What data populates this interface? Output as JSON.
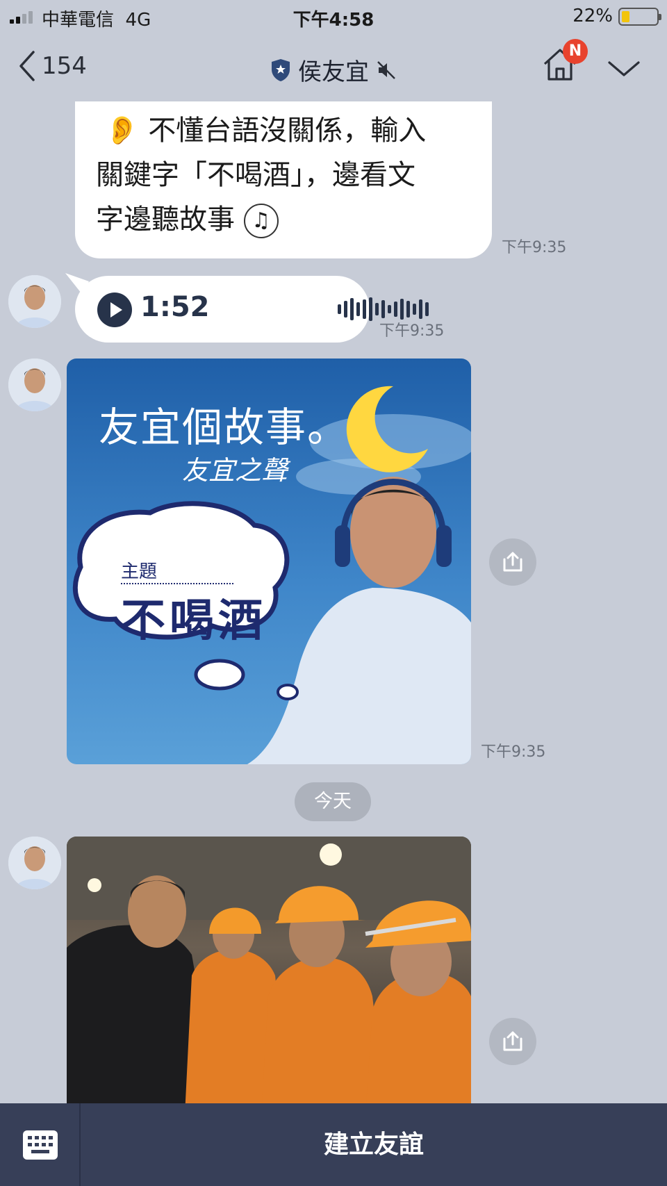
{
  "status_bar": {
    "carrier": "中華電信",
    "network": "4G",
    "time": "下午4:58",
    "battery_percent": "22%",
    "battery_level": 0.22
  },
  "header": {
    "back_count": "154",
    "title": "侯友宜",
    "badge": "N",
    "icons": [
      "chevron-left-icon",
      "shield-star-icon",
      "mute-icon",
      "home-icon",
      "chevron-down-icon"
    ]
  },
  "messages": {
    "text_line1_ear": "👂",
    "text_line1": "不懂台語沒關係，輸入",
    "text_line2": "關鍵字「不喝酒」，邊看文",
    "text_line3": "字邊聽故事",
    "text_note_icon": "♫",
    "text_time": "下午9:35",
    "voice_duration": "1:52",
    "voice_time": "下午9:35",
    "story_image": {
      "headline": "友宜個故事。",
      "subtitle": "友宜之聲",
      "theme_label": "主題",
      "theme": "不喝酒",
      "time": "下午9:35"
    },
    "day_divider": "今天"
  },
  "bottom_bar": {
    "action": "建立友誼"
  },
  "colors": {
    "background": "#c7ccd7",
    "bottom_bar": "#373f58",
    "badge": "#e8432e",
    "voice_accent": "#27334a"
  }
}
